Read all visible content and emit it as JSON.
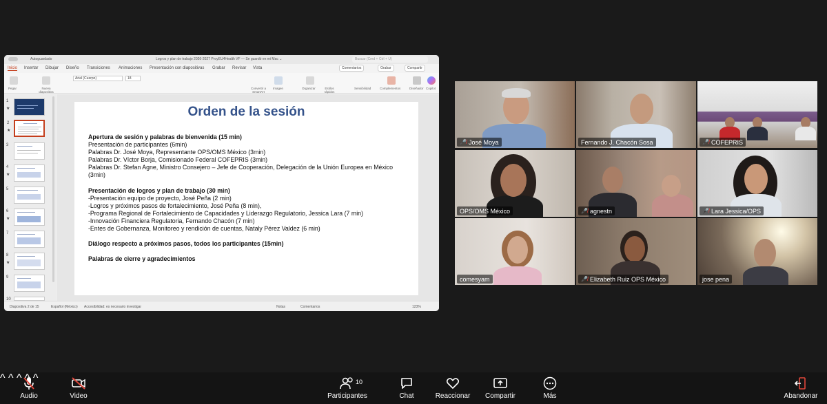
{
  "ppt": {
    "autosave": "Autoguardado",
    "doc_title": "Logros y plan de trabajo 2026-2027 ProyEU4Health VF — Se guardó en mi Mac ⌄",
    "search_placeholder": "Buscar (Cmd + Ctrl + U)",
    "tabs": [
      "Inicio",
      "Insertar",
      "Dibujar",
      "Diseño",
      "Transiciones",
      "Animaciones",
      "Presentación con diapositivas",
      "Grabar",
      "Revisar",
      "Vista"
    ],
    "comments_btn": "Comentarios",
    "record_btn": "Grabar",
    "share_btn": "Compartir",
    "ribbon": {
      "paste": "Pegar",
      "new_slide": "Nueva diapositiva",
      "font": "Arial (Cuerpo)",
      "size": "18",
      "convert": "Convertir a SmartArt",
      "image": "Imagen",
      "arrange": "Organizar",
      "quick_styles": "Estilos rápidos",
      "sensitivity": "Sensibilidad",
      "addins": "Complementos",
      "designer": "Diseñador",
      "copilot": "Copilot"
    },
    "slide_numbers": [
      "1",
      "2",
      "3",
      "4",
      "5",
      "6",
      "7",
      "8",
      "9",
      "10"
    ],
    "slide": {
      "title": "Orden de la sesión",
      "sec1_heading": "Apertura de sesión y palabras de bienvenida (15 min)",
      "sec1_lines": [
        "Presentación de participantes (6min)",
        "Palabras Dr. José Moya, Representante OPS/OMS México (3min)",
        "Palabras Dr. Víctor Borja, Comisionado Federal COFEPRIS (3min)",
        "Palabras Dr. Stefan Agne, Ministro Consejero – Jefe de Cooperación, Delegación de la Unión Europea en México (3min)"
      ],
      "sec2_heading": "Presentación de logros y plan de trabajo (30 min)",
      "sec2_lines": [
        "-Presentación equipo de proyecto, José Peña (2 min)",
        "-Logros y próximos pasos de fortalecimiento, José Peña (8 min),",
        "-Programa Regional de Fortalecimiento de Capacidades y Liderazgo Regulatorio, Jessica Lara (7 min)",
        "-Innovación Financiera Regulatoria, Fernando Chacón (7 min)",
        "-Entes de Gobernanza, Monitoreo y rendición de cuentas, Nataly Pérez Valdez (6 min)"
      ],
      "sec3_heading": "Diálogo respecto a próximos pasos, todos los participantes (15min)",
      "sec4_heading": "Palabras de cierre y agradecimientos"
    },
    "status": {
      "slide_of": "Diapositiva 2 de 15",
      "language": "Español (México)",
      "accessibility": "Accesibilidad: es necesario investigar",
      "notes": "Notas",
      "comments": "Comentarios",
      "zoom": "123%"
    }
  },
  "participants": [
    {
      "name": "José Moya",
      "muted": true
    },
    {
      "name": "Fernando J. Chacón Sosa",
      "muted": false
    },
    {
      "name": "COFEPRIS",
      "muted": true
    },
    {
      "name": "OPS/OMS México",
      "muted": false,
      "active": true
    },
    {
      "name": "agnestn",
      "muted": true
    },
    {
      "name": "Lara Jessica/OPS",
      "muted": true
    },
    {
      "name": "comesyam",
      "muted": false
    },
    {
      "name": "Elizabeth Ruiz OPS México",
      "muted": true
    },
    {
      "name": "jose pena",
      "muted": false
    }
  ],
  "toolbar": {
    "audio": "Audio",
    "video": "Video",
    "participants": "Participantes",
    "participants_count": "10",
    "chat": "Chat",
    "react": "Reaccionar",
    "share": "Compartir",
    "more": "Más",
    "leave": "Abandonar"
  },
  "colors": {
    "active_speaker": "#37c26a",
    "leave": "#e0463a",
    "slide_title": "#34528a",
    "ppt_accent": "#c43e1c"
  }
}
